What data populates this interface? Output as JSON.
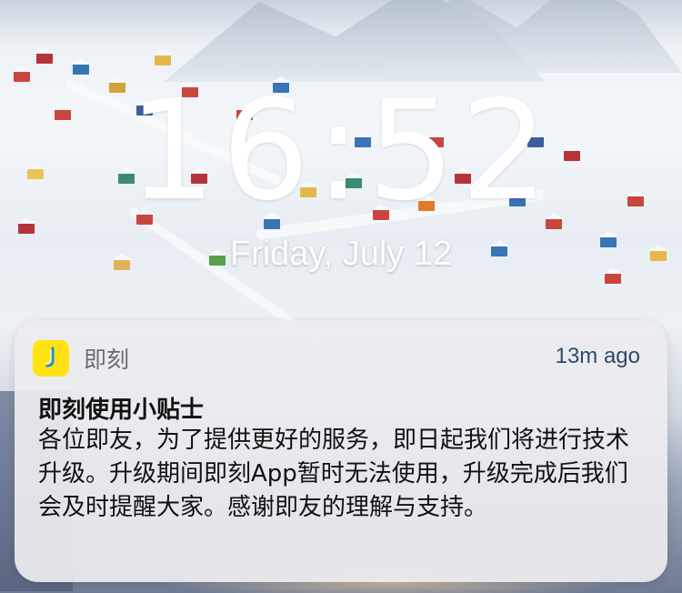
{
  "lockscreen": {
    "time": "16:52",
    "date": "Friday, July 12"
  },
  "notification": {
    "app_icon": "jike-app-icon",
    "app_name": "即刻",
    "time_ago": "13m ago",
    "title": "即刻使用小贴士",
    "body": "各位即友，为了提供更好的服务，即日起我们将进行技术升级。升级期间即刻App暂时无法使用，升级完成后我们会及时提醒大家。感谢即友的理解与支持。"
  },
  "colors": {
    "app_icon_bg": "#ffe411",
    "time_ago_text": "#2e4a6b"
  }
}
